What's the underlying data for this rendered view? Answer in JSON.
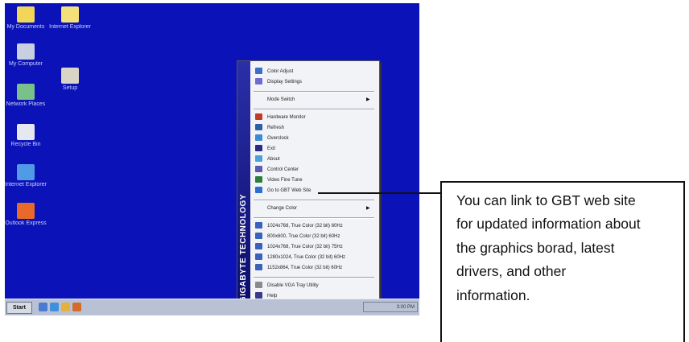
{
  "desktop": {
    "bg": "#0a12b8",
    "icons": [
      {
        "label": "My Documents",
        "icon": "folder-icon",
        "color": "#f1d65a"
      },
      {
        "label": "Internet Explorer",
        "icon": "folder-icon",
        "color": "#f3e07a"
      },
      {
        "label": "My Computer",
        "icon": "computer-icon",
        "color": "#c8cfe0"
      },
      {
        "label": "Setup",
        "icon": "setup-icon",
        "color": "#d9d4c6"
      },
      {
        "label": "Network Places",
        "icon": "network-icon",
        "color": "#7ac08a"
      },
      {
        "label": "Recycle Bin",
        "icon": "recycle-bin-icon",
        "color": "#e5e8f0"
      },
      {
        "label": "Internet Explorer",
        "icon": "browser-icon",
        "color": "#4f9be5"
      },
      {
        "label": "Outlook Express",
        "icon": "mail-icon",
        "color": "#e86a2a"
      }
    ]
  },
  "taskbar": {
    "start_label": "Start",
    "clock": "3:00 PM",
    "quick_launch": [
      {
        "icon": "desktop-icon",
        "color": "#4a7bd1"
      },
      {
        "icon": "browser-icon",
        "color": "#3e8fdc"
      },
      {
        "icon": "mail-icon",
        "color": "#e3b23c"
      },
      {
        "icon": "media-icon",
        "color": "#d46b2a"
      }
    ]
  },
  "menu": {
    "sidebar_text": "GIGABYTE TECHNOLOGY",
    "groups": [
      [
        {
          "label": "Color Adjust",
          "icon": "color-adjust-icon",
          "color": "#3a6fc4"
        },
        {
          "label": "Display Settings",
          "icon": "display-settings-icon",
          "color": "#6b6bd0"
        }
      ],
      [
        {
          "label": "Mode Switch",
          "icon": "",
          "color": "#000000",
          "submenu": true
        }
      ],
      [
        {
          "label": "Hardware Monitor",
          "icon": "monitor-icon",
          "color": "#c03a2a"
        },
        {
          "label": "Refresh",
          "icon": "refresh-icon",
          "color": "#2a5fa8"
        },
        {
          "label": "Overclock",
          "icon": "overclock-icon",
          "color": "#3a8ad4"
        },
        {
          "label": "Exit",
          "icon": "exit-icon",
          "color": "#2a2a8a"
        },
        {
          "label": "About",
          "icon": "about-icon",
          "color": "#4aa0d8"
        },
        {
          "label": "Control Center",
          "icon": "control-icon",
          "color": "#5a5ab0"
        },
        {
          "label": "Video Fine Tune",
          "icon": "tune-icon",
          "color": "#2c7c3c"
        },
        {
          "label": "Go to GBT Web Site",
          "icon": "globe-icon",
          "color": "#2a6fd0"
        }
      ],
      [
        {
          "label": "Change Color",
          "icon": "",
          "color": "#000000",
          "submenu": true
        }
      ],
      [
        {
          "label": "1024x768, True Color (32 bit) 60Hz",
          "icon": "resolution-icon",
          "color": "#3a62b8"
        },
        {
          "label": "800x600, True Color (32 bit) 60Hz",
          "icon": "resolution-icon",
          "color": "#3a62b8"
        },
        {
          "label": "1024x768, True Color (32 bit) 75Hz",
          "icon": "resolution-icon",
          "color": "#3a62b8"
        },
        {
          "label": "1280x1024, True Color (32 bit) 60Hz",
          "icon": "resolution-icon",
          "color": "#3a62b8"
        },
        {
          "label": "1152x864, True Color (32 bit) 60Hz",
          "icon": "resolution-icon",
          "color": "#3a62b8"
        }
      ],
      [
        {
          "label": "Disable VGA Tray Utility",
          "icon": "disable-icon",
          "color": "#8a8a8a"
        },
        {
          "label": "Help",
          "icon": "help-icon",
          "color": "#3a3a8a"
        }
      ]
    ]
  },
  "callout": {
    "lines": [
      "You can link to GBT web site",
      "for updated information about",
      "the graphics borad, latest",
      "drivers, and other",
      "information."
    ]
  }
}
